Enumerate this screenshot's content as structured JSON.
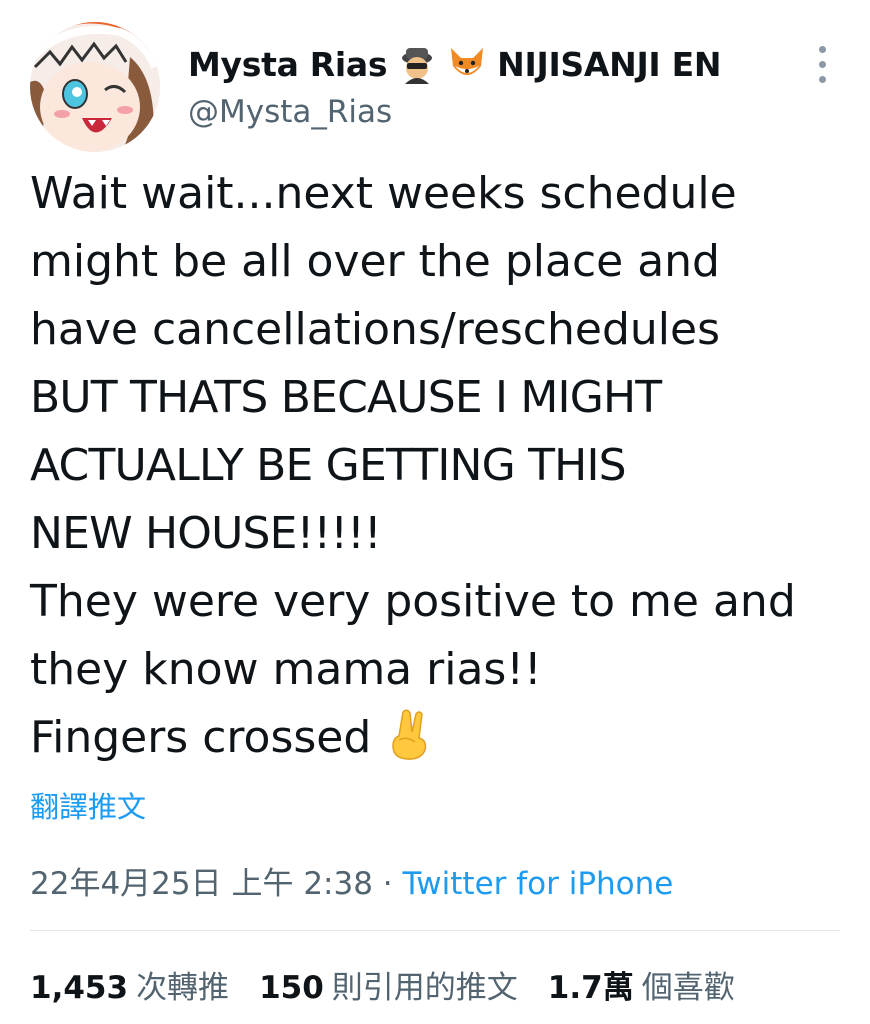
{
  "user": {
    "display_name": "Mysta Rias",
    "affiliation": "NIJISANJI EN",
    "handle": "@Mysta_Rias",
    "badges": [
      "detective-icon",
      "fox-icon"
    ]
  },
  "tweet": {
    "lines": [
      "Wait wait...next weeks schedule",
      "might be all over the place and",
      "have cancellations/reschedules",
      "BUT THATS BECAUSE I MIGHT",
      "ACTUALLY BE GETTING THIS",
      "NEW HOUSE!!!!!",
      "They were very positive to me and",
      "they know mama rias!!",
      "Fingers crossed"
    ],
    "trailing_emoji": "crossed-fingers-icon",
    "translate_label": "翻譯推文"
  },
  "meta": {
    "timestamp": "22年4月25日 上午 2:38",
    "separator": " · ",
    "source": "Twitter for iPhone"
  },
  "stats": {
    "retweets_count": "1,453",
    "retweets_label": "次轉推",
    "quotes_count": "150",
    "quotes_label": "則引用的推文",
    "likes_count": "1.7萬",
    "likes_label": "個喜歡"
  },
  "colors": {
    "link": "#1d9bf0",
    "secondary_text": "#536471",
    "primary_text": "#0f1419"
  }
}
